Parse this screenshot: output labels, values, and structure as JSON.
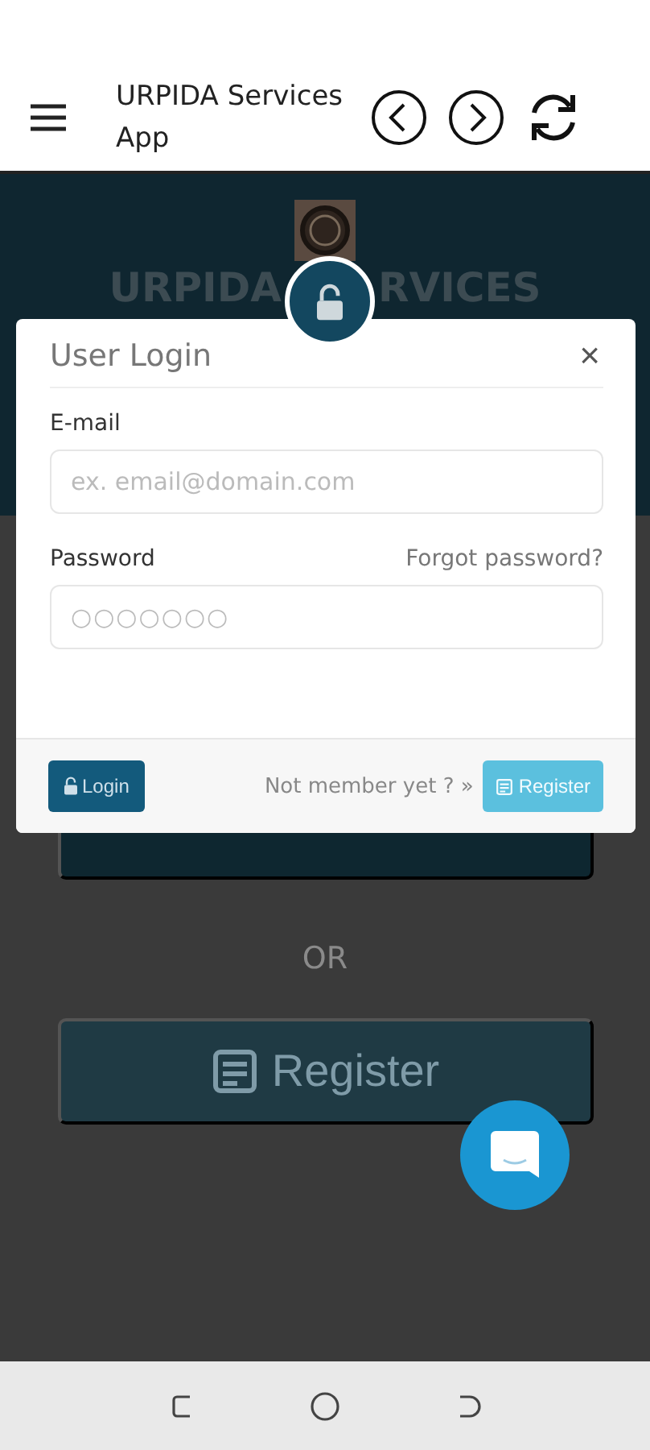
{
  "app_bar": {
    "title": "URPIDA Services App"
  },
  "background": {
    "heading_left": "URPIDA",
    "heading_right": "RVICES",
    "or": "OR",
    "register_button": "Register"
  },
  "dialog": {
    "title": "User Login",
    "close": "×",
    "fields": [
      {
        "kind": "email",
        "label": "E-mail",
        "placeholder": "ex. email@domain.com"
      },
      {
        "kind": "password",
        "label": "Password",
        "link": "Forgot password?",
        "placeholder": "○○○○○○○"
      }
    ],
    "login_button": "Login",
    "prompt": "Not member yet ? »",
    "register_button": "Register"
  }
}
